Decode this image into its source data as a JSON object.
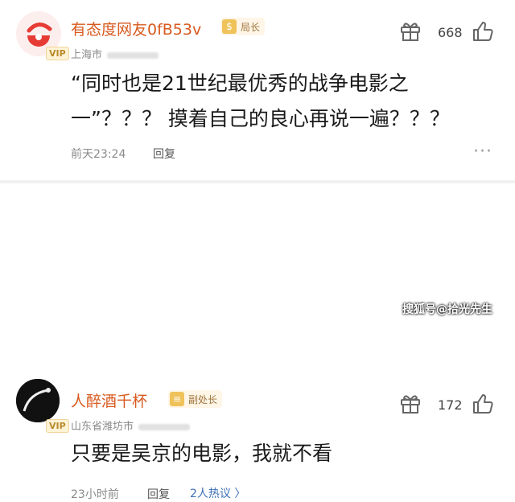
{
  "comments": [
    {
      "username": "有态度网友0fB53v",
      "badge": "局长",
      "badge_icon": "$",
      "vip": "VIP",
      "location": "上海市",
      "likes": "668",
      "text_line1": "“同时也是21世纪最优秀的战争电影之",
      "text_line2": "一”？？？ 摸着自己的良心再说一遍？？？",
      "time": "前天23:24",
      "reply": "回复",
      "more": "···"
    },
    {
      "username": "人醉酒千杯",
      "badge": "副处长",
      "badge_icon": "≡",
      "vip": "VIP",
      "location": "山东省潍坊市",
      "likes": "172",
      "text_line1": "只要是吴京的电影，我就不看",
      "time": "23小时前",
      "reply": "回复",
      "hot_replies": "2人热议 〉"
    }
  ],
  "watermark": "搜狐号@拾光先生",
  "colors": {
    "username": "#d85a1f",
    "badge_bg": "#fff6e8",
    "link": "#3b6fb6"
  }
}
